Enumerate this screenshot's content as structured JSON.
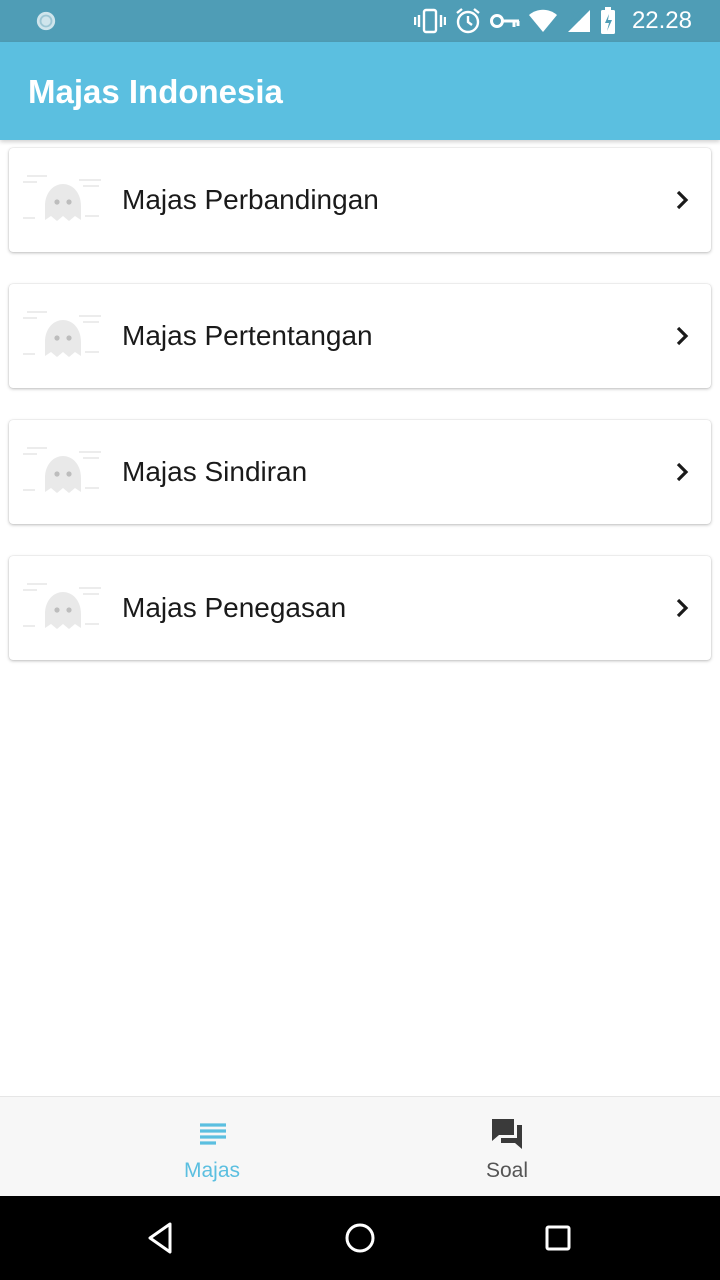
{
  "status_bar": {
    "time": "22.28",
    "icons": [
      "notification-icon",
      "vibrate-icon",
      "alarm-icon",
      "vpn-key-icon",
      "wifi-icon",
      "signal-icon",
      "battery-icon"
    ]
  },
  "app_bar": {
    "title": "Majas Indonesia"
  },
  "list": {
    "items": [
      {
        "label": "Majas Perbandingan",
        "icon": "ghost-icon"
      },
      {
        "label": "Majas Pertentangan",
        "icon": "ghost-icon"
      },
      {
        "label": "Majas Sindiran",
        "icon": "ghost-icon"
      },
      {
        "label": "Majas Penegasan",
        "icon": "ghost-icon"
      }
    ]
  },
  "bottom_nav": {
    "items": [
      {
        "label": "Majas",
        "icon": "list-icon",
        "active": true
      },
      {
        "label": "Soal",
        "icon": "forum-icon",
        "active": false
      }
    ]
  },
  "colors": {
    "status_bar": "#4f9db6",
    "app_bar": "#5bbfe0",
    "accent": "#5bbfe0",
    "inactive": "#555555"
  }
}
